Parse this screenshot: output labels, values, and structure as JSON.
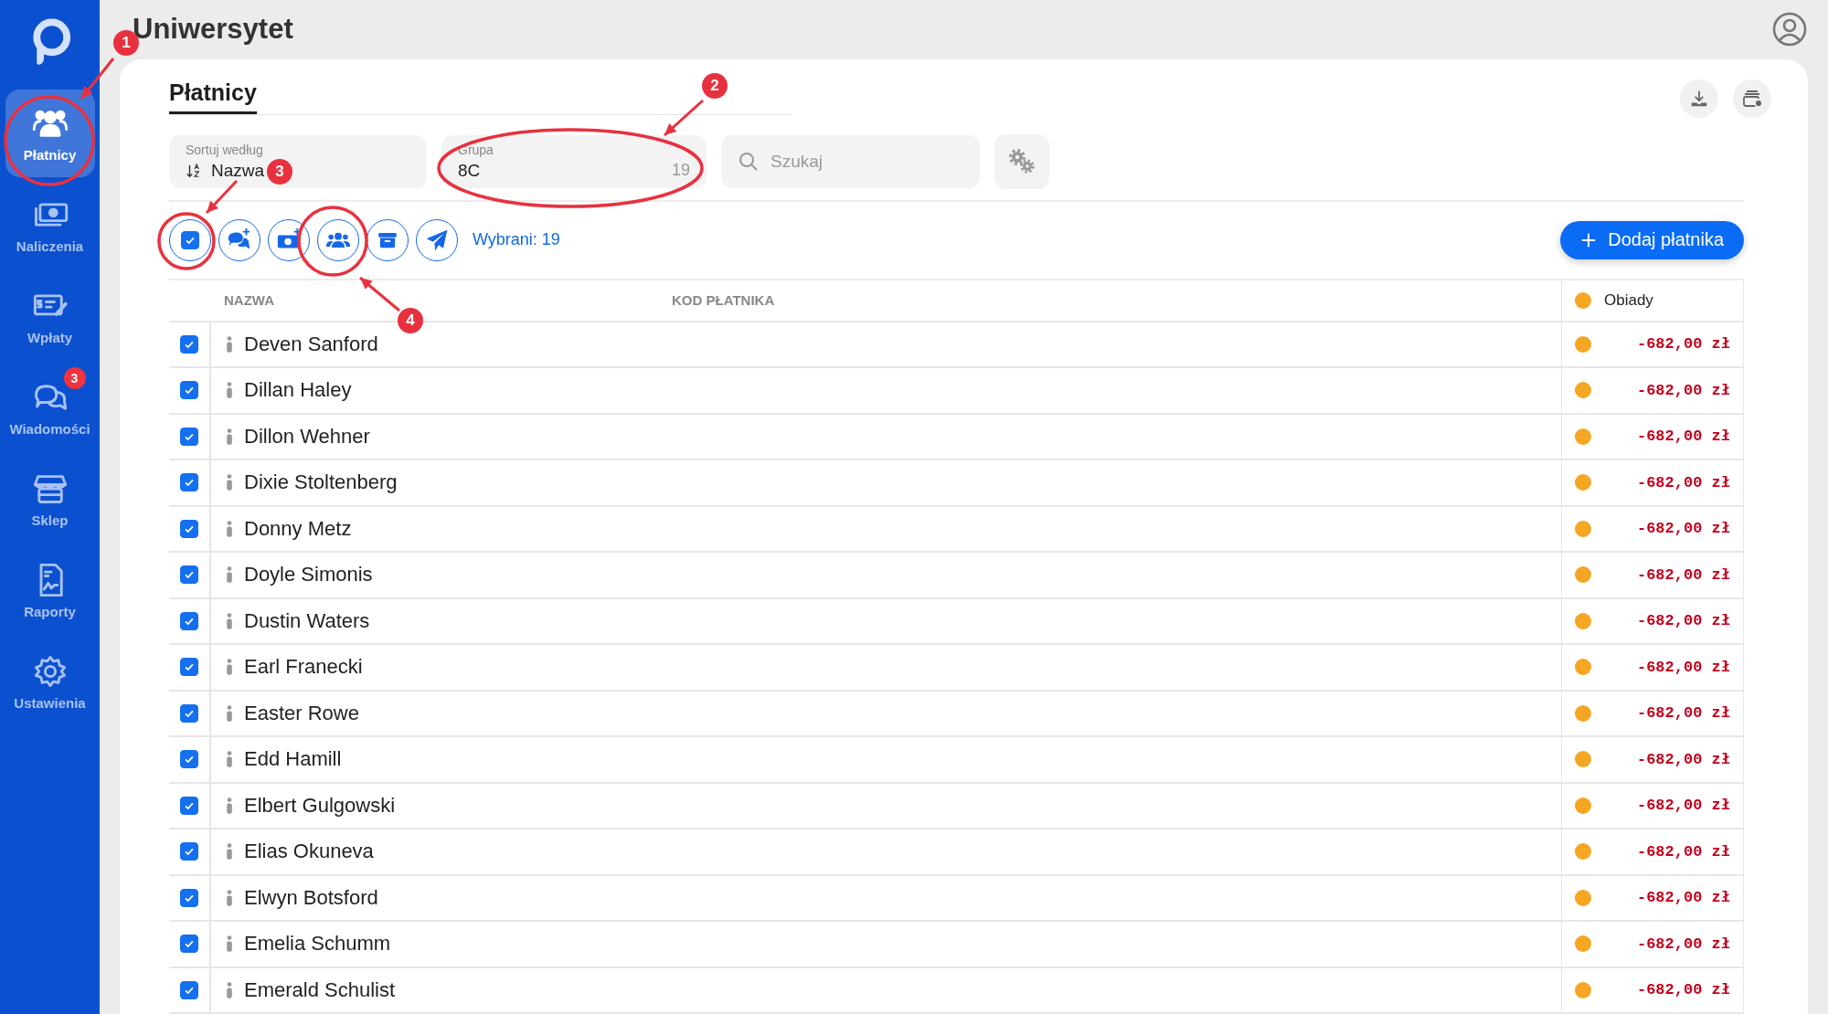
{
  "sidebar": {
    "items": [
      {
        "label": "Płatnicy",
        "selected": true
      },
      {
        "label": "Naliczenia",
        "selected": false
      },
      {
        "label": "Wpłaty",
        "selected": false
      },
      {
        "label": "Wiadomości",
        "selected": false,
        "badge": "3"
      },
      {
        "label": "Sklep",
        "selected": false
      },
      {
        "label": "Raporty",
        "selected": false
      },
      {
        "label": "Ustawienia",
        "selected": false
      }
    ]
  },
  "header": {
    "title": "Uniwersytet"
  },
  "card": {
    "tab": "Płatnicy"
  },
  "filters": {
    "sort": {
      "label": "Sortuj według",
      "value": "Nazwa"
    },
    "group": {
      "label": "Grupa",
      "value": "8C",
      "count": "19"
    },
    "search": {
      "placeholder": "Szukaj"
    }
  },
  "toolbar": {
    "select_all_checked": true,
    "selected_text": "Wybrani: 19",
    "add_button": "Dodaj płatnika"
  },
  "table": {
    "columns": [
      "NAZWA",
      "KOD PŁATNIKA"
    ],
    "category": {
      "name": "Obiady",
      "color": "#f5a623"
    },
    "rows": [
      {
        "name": "Deven Sanford",
        "checked": true,
        "amount": "-682,00 zł"
      },
      {
        "name": "Dillan Haley",
        "checked": true,
        "amount": "-682,00 zł"
      },
      {
        "name": "Dillon Wehner",
        "checked": true,
        "amount": "-682,00 zł"
      },
      {
        "name": "Dixie Stoltenberg",
        "checked": true,
        "amount": "-682,00 zł"
      },
      {
        "name": "Donny Metz",
        "checked": true,
        "amount": "-682,00 zł"
      },
      {
        "name": "Doyle Simonis",
        "checked": true,
        "amount": "-682,00 zł"
      },
      {
        "name": "Dustin Waters",
        "checked": true,
        "amount": "-682,00 zł"
      },
      {
        "name": "Earl Franecki",
        "checked": true,
        "amount": "-682,00 zł"
      },
      {
        "name": "Easter Rowe",
        "checked": true,
        "amount": "-682,00 zł"
      },
      {
        "name": "Edd Hamill",
        "checked": true,
        "amount": "-682,00 zł"
      },
      {
        "name": "Elbert Gulgowski",
        "checked": true,
        "amount": "-682,00 zł"
      },
      {
        "name": "Elias Okuneva",
        "checked": true,
        "amount": "-682,00 zł"
      },
      {
        "name": "Elwyn Botsford",
        "checked": true,
        "amount": "-682,00 zł"
      },
      {
        "name": "Emelia Schumm",
        "checked": true,
        "amount": "-682,00 zł"
      },
      {
        "name": "Emerald Schulist",
        "checked": true,
        "amount": "-682,00 zł"
      }
    ]
  },
  "annotations": [
    {
      "number": "1"
    },
    {
      "number": "2"
    },
    {
      "number": "3"
    },
    {
      "number": "4"
    }
  ]
}
